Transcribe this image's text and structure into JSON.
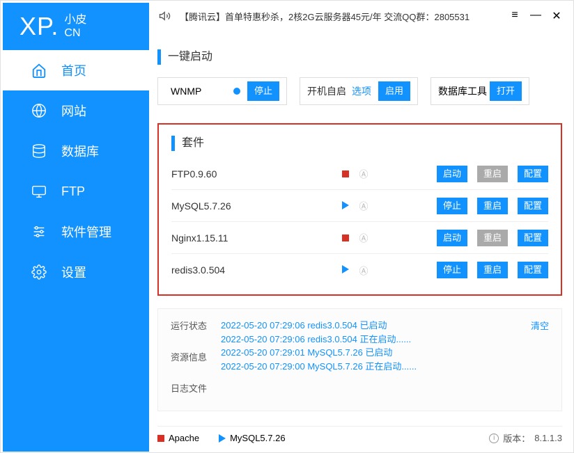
{
  "titlebar": {
    "announce": "【腾讯云】首单特惠秒杀，2核2G云服务器45元/年 交流QQ群：2805531"
  },
  "logo": {
    "xp": "XP.",
    "cn_top": "小皮",
    "cn_bot": "CN"
  },
  "nav": {
    "home": "首页",
    "site": "网站",
    "db": "数据库",
    "ftp": "FTP",
    "soft": "软件管理",
    "settings": "设置"
  },
  "quick": {
    "title": "一键启动",
    "wnmp": "WNMP",
    "stop": "停止",
    "autostart_label": "开机自启",
    "options": "选项",
    "enable": "启用",
    "db_tool": "数据库工具",
    "open": "打开"
  },
  "suite": {
    "title": "套件",
    "a_badge": "Ⓐ",
    "items": [
      {
        "name": "FTP0.9.60",
        "running": false,
        "restart_gray": true
      },
      {
        "name": "MySQL5.7.26",
        "running": true,
        "restart_gray": false
      },
      {
        "name": "Nginx1.15.11",
        "running": false,
        "restart_gray": true
      },
      {
        "name": "redis3.0.504",
        "running": true,
        "restart_gray": false
      }
    ],
    "btn_start": "启动",
    "btn_stop": "停止",
    "btn_restart": "重启",
    "btn_config": "配置"
  },
  "log": {
    "run_status": "运行状态",
    "res_info": "资源信息",
    "log_file": "日志文件",
    "clear": "清空",
    "lines": [
      "2022-05-20 07:29:06 redis3.0.504 已启动",
      "2022-05-20 07:29:06 redis3.0.504 正在启动......",
      "2022-05-20 07:29:01 MySQL5.7.26 已启动",
      "2022-05-20 07:29:00 MySQL5.7.26 正在启动......"
    ]
  },
  "footer": {
    "apache": "Apache",
    "mysql": "MySQL5.7.26",
    "version_label": "版本：",
    "version": "8.1.1.3"
  }
}
